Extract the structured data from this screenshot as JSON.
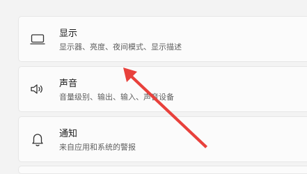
{
  "settings": {
    "items": [
      {
        "title": "显示",
        "description": "显示器、亮度、夜间模式、显示描述",
        "icon": "monitor-icon"
      },
      {
        "title": "声音",
        "description": "音量级别、输出、输入、声音设备",
        "icon": "speaker-icon"
      },
      {
        "title": "通知",
        "description": "来自应用和系统的警报",
        "icon": "bell-icon"
      }
    ]
  },
  "annotation": {
    "type": "arrow",
    "color": "#e8413c",
    "points_to": "显示"
  },
  "colors": {
    "background": "#f3f3f3",
    "card": "#fbfbfb",
    "card_border": "#e6e6e6",
    "title": "#1a1a1a",
    "description": "#5f5f5f"
  }
}
